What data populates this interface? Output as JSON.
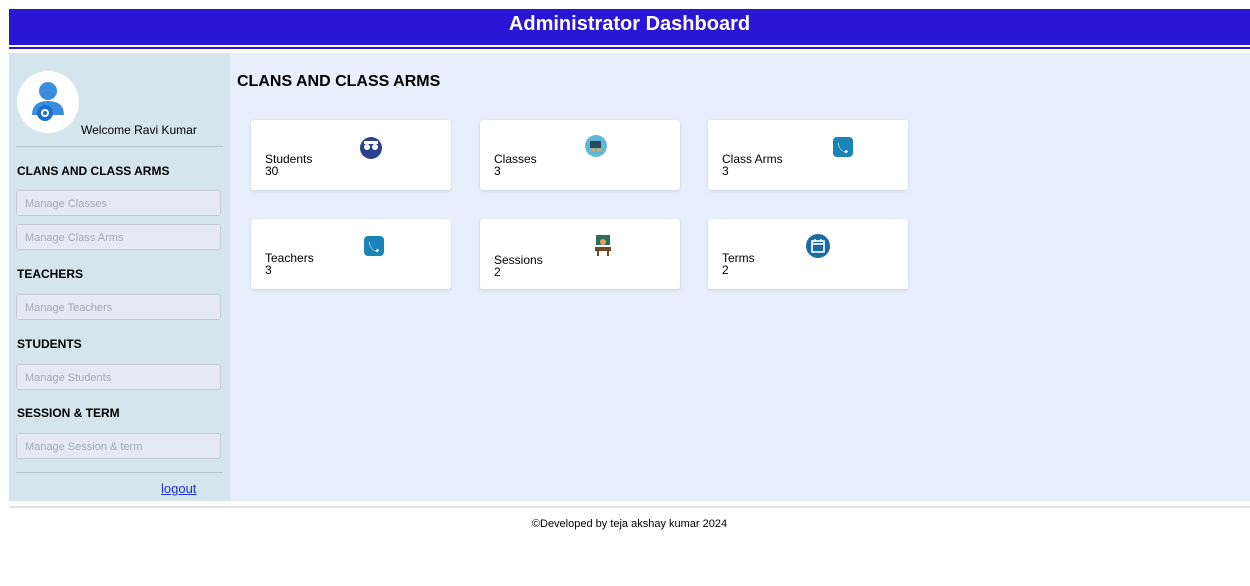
{
  "header": {
    "title": "Administrator Dashboard"
  },
  "sidebar": {
    "welcome": "Welcome Ravi Kumar",
    "sections": [
      {
        "title": "CLANS AND CLASS ARMS"
      },
      {
        "title": "TEACHERS"
      },
      {
        "title": "STUDENTS"
      },
      {
        "title": "SESSION & TERM"
      }
    ],
    "items": [
      {
        "label": "Manage Classes"
      },
      {
        "label": "Manage Class Arms"
      },
      {
        "label": "Manage Teachers"
      },
      {
        "label": "Manage Students"
      },
      {
        "label": "Manage Session & term"
      }
    ],
    "logout": "logout"
  },
  "content": {
    "title": "CLANS AND CLASS ARMS",
    "cards": [
      {
        "label": "Students",
        "value": "30",
        "icon": "graduates-icon"
      },
      {
        "label": "Classes",
        "value": "3",
        "icon": "classroom-icon"
      },
      {
        "label": "Class Arms",
        "value": "3",
        "icon": "phone-icon"
      },
      {
        "label": "Teachers",
        "value": "3",
        "icon": "phone-icon"
      },
      {
        "label": "Sessions",
        "value": "2",
        "icon": "teacher-desk-icon"
      },
      {
        "label": "Terms",
        "value": "2",
        "icon": "calendar-icon"
      }
    ]
  },
  "footer": {
    "text": "©Developed by teja akshay kumar 2024"
  },
  "colors": {
    "header": "#2a17d6",
    "sidebar": "#d5e5ee",
    "main_bg": "#e8effc",
    "link": "#1c2fe0"
  }
}
